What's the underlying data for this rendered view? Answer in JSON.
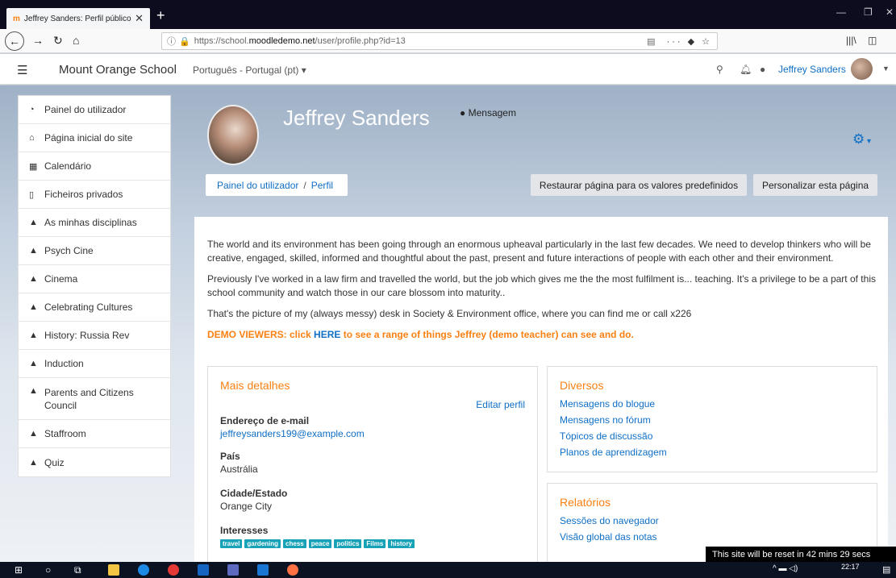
{
  "browser": {
    "tab_title": "Jeffrey Sanders: Perfil público",
    "url_prefix": "https://school.",
    "url_domain": "moodledemo.net",
    "url_suffix": "/user/profile.php?id=13"
  },
  "header": {
    "site_name": "Mount Orange School",
    "language": "Português - Portugal (pt)",
    "user_name": "Jeffrey Sanders"
  },
  "drawer": {
    "items": [
      {
        "label": "Painel do utilizador",
        "icon": "dashboard-icon"
      },
      {
        "label": "Página inicial do site",
        "icon": "home-icon"
      },
      {
        "label": "Calendário",
        "icon": "calendar-icon"
      },
      {
        "label": "Ficheiros privados",
        "icon": "file-icon"
      },
      {
        "label": "As minhas disciplinas",
        "icon": "graduation-cap-icon"
      },
      {
        "label": "Psych Cine",
        "icon": "graduation-cap-icon"
      },
      {
        "label": "Cinema",
        "icon": "graduation-cap-icon"
      },
      {
        "label": "Celebrating Cultures",
        "icon": "graduation-cap-icon"
      },
      {
        "label": "History: Russia Rev",
        "icon": "graduation-cap-icon"
      },
      {
        "label": "Induction",
        "icon": "graduation-cap-icon"
      },
      {
        "label": "Parents and Citizens Council",
        "icon": "graduation-cap-icon"
      },
      {
        "label": "Staffroom",
        "icon": "graduation-cap-icon"
      },
      {
        "label": "Quiz",
        "icon": "graduation-cap-icon"
      }
    ]
  },
  "profile": {
    "name": "Jeffrey Sanders",
    "message_label": "Mensagem",
    "breadcrumb": [
      "Painel do utilizador",
      "Perfil"
    ],
    "reset_button": "Restaurar página para os valores predefinidos",
    "customise_button": "Personalizar esta página"
  },
  "description": {
    "p1": "The world and its environment has been going through an enormous upheaval particularly in the last few decades. We need to develop thinkers who will be creative, engaged, skilled, informed and thoughtful about the past, present and future interactions of people with each other and their environment.",
    "p2": "Previously I've worked in a law firm and travelled the world,  but the job which gives me the the most fulfilment is... teaching. It's a privilege to be a part of this school community and watch those in our care blossom into maturity..",
    "p3": "That's the picture of my (always messy) desk in Society & Environment office, where you can find me or call x226",
    "demo_prefix": "DEMO VIEWERS: click ",
    "demo_link": "HERE",
    "demo_suffix": " to see a range of things Jeffrey (demo teacher) can see and do."
  },
  "details": {
    "title": "Mais detalhes",
    "edit_link": "Editar perfil",
    "email_label": "Endereço de e-mail",
    "email_value": "jeffreysanders199@example.com",
    "country_label": "País",
    "country_value": "Austrália",
    "city_label": "Cidade/Estado",
    "city_value": "Orange City",
    "interests_label": "Interesses",
    "interests": [
      "travel",
      "gardening",
      "chess",
      "peace",
      "politics",
      "Films",
      "history"
    ]
  },
  "misc": {
    "title": "Diversos",
    "links": [
      "Mensagens do blogue",
      "Mensagens no fórum",
      "Tópicos de discussão",
      "Planos de aprendizagem"
    ]
  },
  "reports": {
    "title": "Relatórios",
    "links": [
      "Sessões do navegador",
      "Visão global das notas"
    ]
  },
  "toast": "This site will be reset in 42 mins 29 secs",
  "taskbar": {
    "time": "22:17"
  },
  "colors": {
    "accent": "#0f6fc5",
    "brand": "#f98012",
    "tag": "#17a2b8"
  }
}
